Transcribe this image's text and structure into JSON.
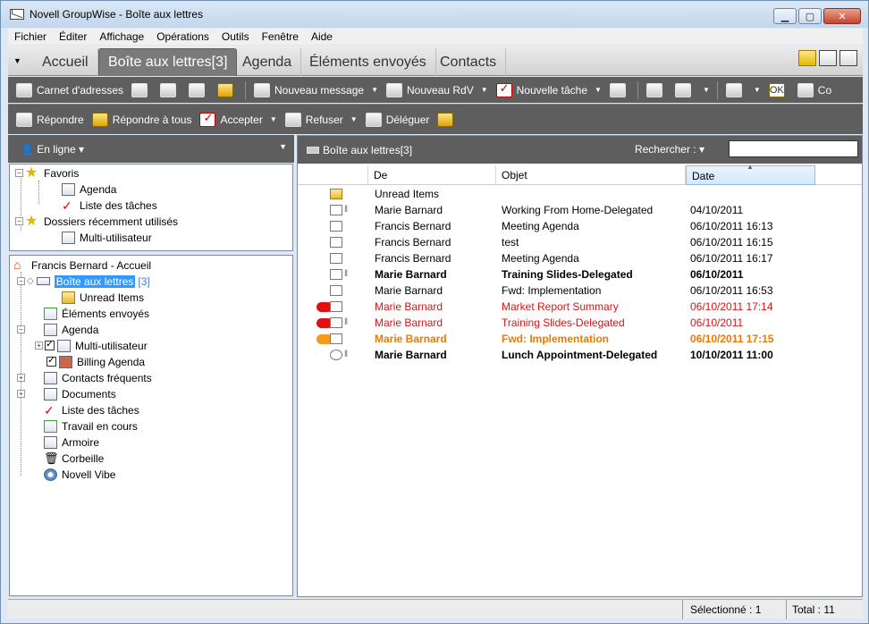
{
  "window": {
    "title": "Novell GroupWise - Boîte aux lettres",
    "minimize": "▁",
    "maximize": "▢",
    "close": "✕"
  },
  "menu": [
    "Fichier",
    "Éditer",
    "Affichage",
    "Opérations",
    "Outils",
    "Fenêtre",
    "Aide"
  ],
  "tabs": [
    "Accueil",
    "Boîte aux lettres[3]",
    "Agenda",
    "Éléments envoyés",
    "Contacts"
  ],
  "active_tab": 1,
  "toolbar1": {
    "address_book": "Carnet d'adresses",
    "new_message": "Nouveau message",
    "new_appointment": "Nouveau RdV",
    "new_task": "Nouvelle tâche",
    "co": "Co",
    "ok_icon_text": "OK"
  },
  "toolbar2": {
    "reply": "Répondre",
    "reply_all": "Répondre à tous",
    "accept": "Accepter",
    "decline": "Refuser",
    "delegate": "Déléguer"
  },
  "left": {
    "status": "En ligne",
    "favorites": {
      "label": "Favoris",
      "items": [
        "Agenda",
        "Liste des tâches"
      ]
    },
    "recent": {
      "label": "Dossiers récemment utilisés",
      "items": [
        "Multi-utilisateur"
      ]
    },
    "tree": {
      "root": "Francis Bernard - Accueil",
      "mailbox": "Boîte aux lettres",
      "mailbox_count": "[3]",
      "unread": "Unread Items",
      "sent": "Éléments envoyés",
      "calendar": "Agenda",
      "multi": "Multi-utilisateur",
      "billing": "Billing Agenda",
      "contacts": "Contacts fréquents",
      "documents": "Documents",
      "tasks": "Liste des tâches",
      "work": "Travail en cours",
      "cabinet": "Armoire",
      "trash": "Corbeille",
      "vibe": "Novell Vibe"
    }
  },
  "right": {
    "title": "Boîte aux lettres[3]",
    "search_label": "Rechercher :",
    "search_value": "",
    "columns": {
      "from": "De",
      "subject": "Objet",
      "date": "Date"
    },
    "rows": [
      {
        "from": "Unread Items",
        "subject": "",
        "date": "",
        "style": "normal",
        "icon": "folder",
        "clip": false,
        "pill": ""
      },
      {
        "from": "Marie Barnard",
        "subject": "Working From Home-Delegated",
        "date": "04/10/2011",
        "style": "normal",
        "icon": "edit",
        "clip": true,
        "pill": ""
      },
      {
        "from": "Francis Bernard",
        "subject": "Meeting Agenda",
        "date": "06/10/2011 16:13",
        "style": "normal",
        "icon": "mail",
        "clip": false,
        "pill": ""
      },
      {
        "from": "Francis Bernard",
        "subject": "test",
        "date": "06/10/2011 16:15",
        "style": "normal",
        "icon": "mail",
        "clip": false,
        "pill": ""
      },
      {
        "from": "Francis Bernard",
        "subject": "Meeting Agenda",
        "date": "06/10/2011 16:17",
        "style": "normal",
        "icon": "doc",
        "clip": false,
        "pill": ""
      },
      {
        "from": "Marie Barnard",
        "subject": "Training Slides-Delegated",
        "date": "06/10/2011",
        "style": "bold",
        "icon": "cal",
        "clip": true,
        "pill": ""
      },
      {
        "from": "Marie Barnard",
        "subject": "Fwd: Implementation",
        "date": "06/10/2011 16:53",
        "style": "normal",
        "icon": "mail",
        "clip": false,
        "pill": ""
      },
      {
        "from": "Marie Barnard",
        "subject": "Market Report Summary",
        "date": "06/10/2011 17:14",
        "style": "red",
        "icon": "mail",
        "clip": false,
        "pill": "#e01010"
      },
      {
        "from": "Marie Barnard",
        "subject": "Training Slides-Delegated",
        "date": "06/10/2011",
        "style": "red",
        "icon": "cal",
        "clip": true,
        "pill": "#e01010"
      },
      {
        "from": "Marie Barnard",
        "subject": "Fwd: Implementation",
        "date": "06/10/2011 17:15",
        "style": "orange",
        "icon": "mail",
        "clip": false,
        "pill": "#f59a1a"
      },
      {
        "from": "Marie Barnard",
        "subject": "Lunch Appointment-Delegated",
        "date": "10/10/2011 11:00",
        "style": "bold",
        "icon": "clock",
        "clip": true,
        "pill": ""
      }
    ]
  },
  "status": {
    "selected": "Sélectionné : 1",
    "total": "Total : 11"
  }
}
